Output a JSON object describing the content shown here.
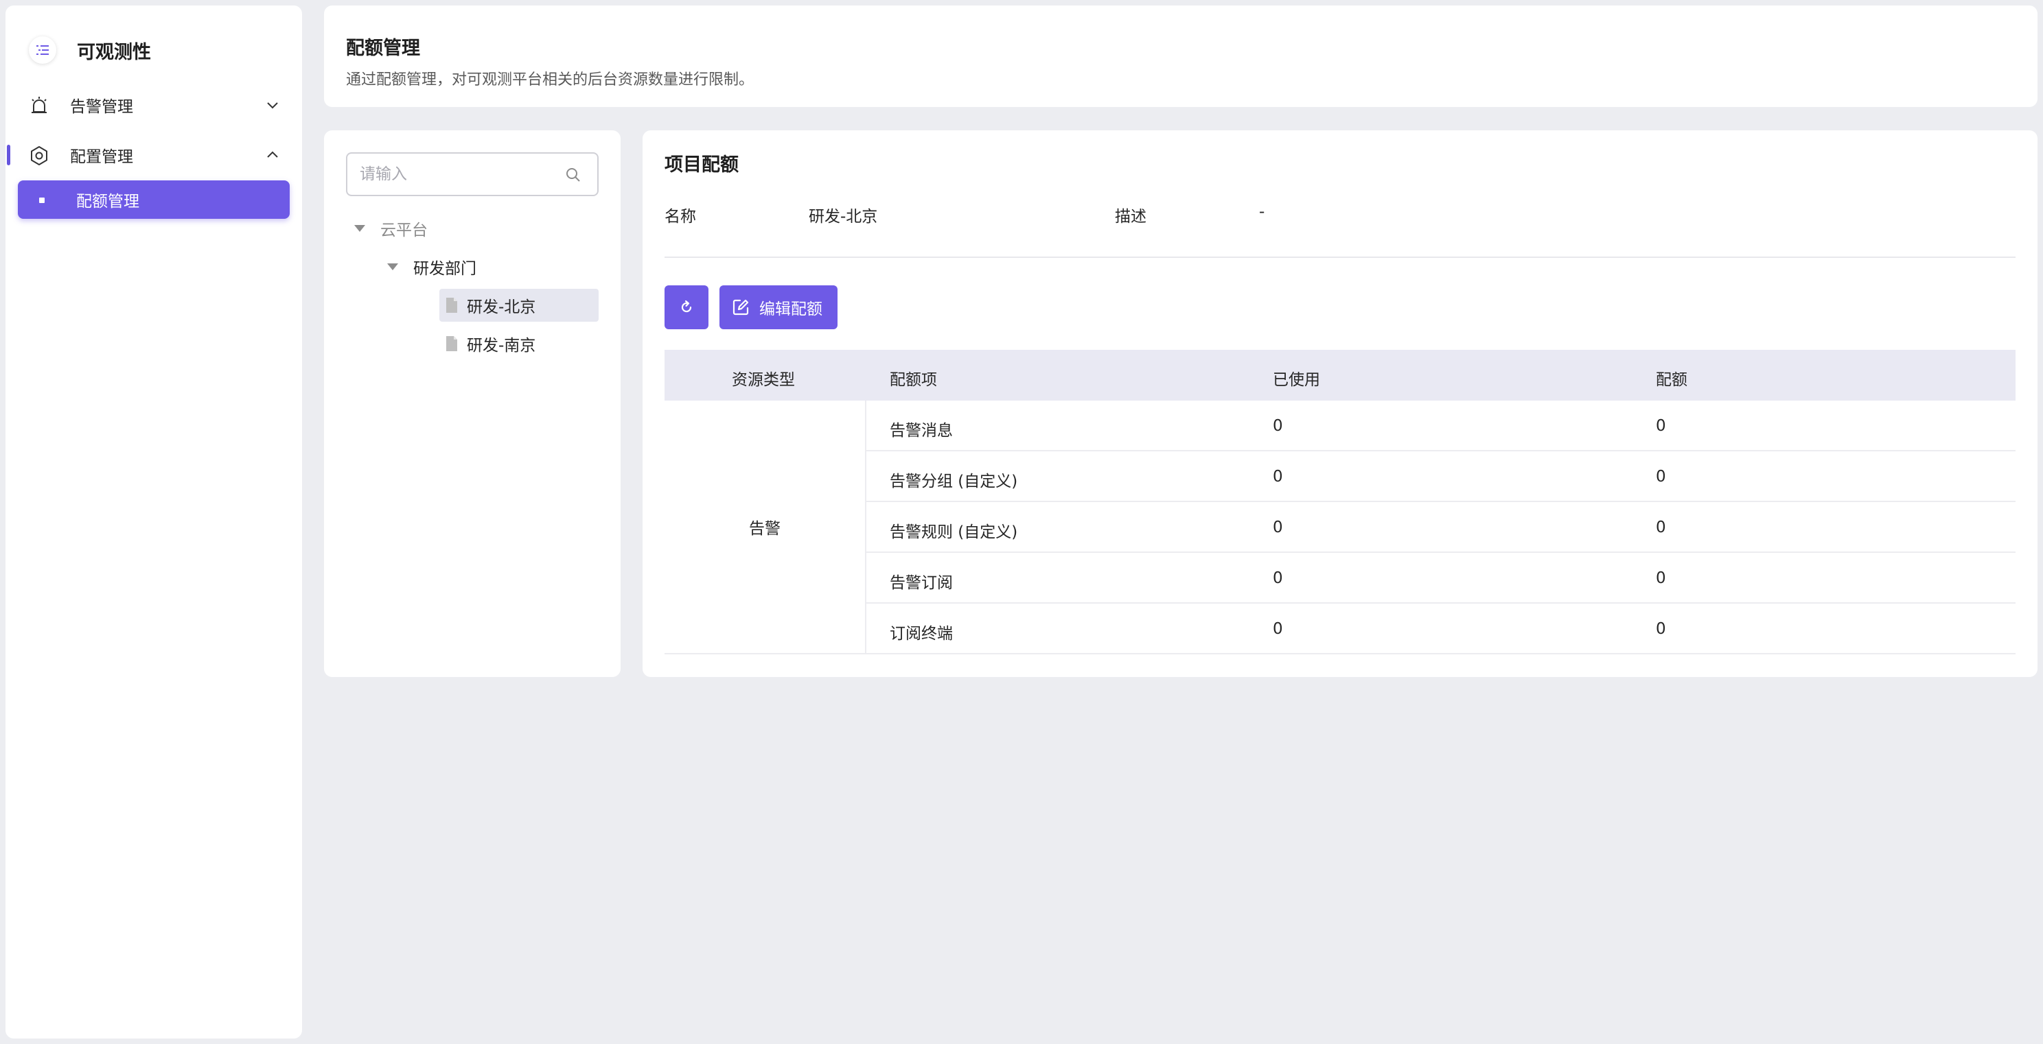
{
  "app": {
    "title": "可观测性"
  },
  "sidebar": {
    "items": [
      {
        "label": "告警管理",
        "expanded": false
      },
      {
        "label": "配置管理",
        "expanded": true
      }
    ],
    "sub_items": [
      {
        "label": "配额管理",
        "active": true
      }
    ]
  },
  "header": {
    "title": "配额管理",
    "description": "通过配额管理，对可观测平台相关的后台资源数量进行限制。"
  },
  "tree": {
    "search_placeholder": "请输入",
    "nodes": [
      {
        "label": "云平台",
        "level": 0,
        "type": "folder"
      },
      {
        "label": "研发部门",
        "level": 1,
        "type": "folder"
      },
      {
        "label": "研发-北京",
        "level": 2,
        "type": "leaf",
        "selected": true
      },
      {
        "label": "研发-南京",
        "level": 2,
        "type": "leaf",
        "selected": false
      }
    ]
  },
  "project": {
    "title": "项目配额",
    "name_label": "名称",
    "name_value": "研发-北京",
    "desc_label": "描述",
    "desc_value": "-"
  },
  "toolbar": {
    "edit_label": "编辑配额"
  },
  "table": {
    "columns": [
      "资源类型",
      "配额项",
      "已使用",
      "配额"
    ],
    "group": "告警",
    "rows": [
      {
        "item": "告警消息",
        "used": "0",
        "quota": "0"
      },
      {
        "item": "告警分组 (自定义)",
        "used": "0",
        "quota": "0"
      },
      {
        "item": "告警规则 (自定义)",
        "used": "0",
        "quota": "0"
      },
      {
        "item": "告警订阅",
        "used": "0",
        "quota": "0"
      },
      {
        "item": "订阅终端",
        "used": "0",
        "quota": "0"
      }
    ]
  },
  "colors": {
    "primary": "#6e5ae6",
    "background": "#ecedf1"
  }
}
